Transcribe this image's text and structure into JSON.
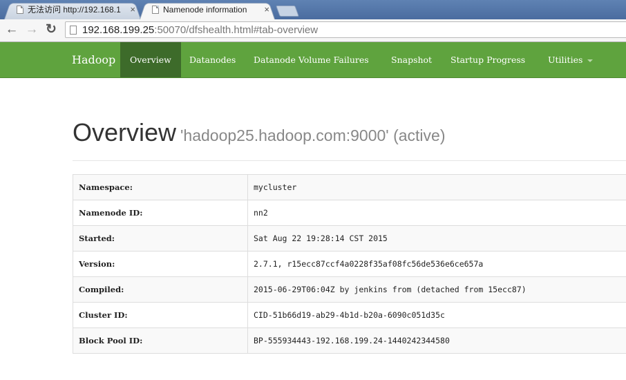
{
  "browser": {
    "tabs": [
      {
        "title": "无法访问 http://192.168.1",
        "close": "×"
      },
      {
        "title": "Namenode information",
        "close": "×"
      }
    ],
    "nav": {
      "back": "←",
      "forward": "→",
      "reload": "↻"
    },
    "url": {
      "host": "192.168.199.25",
      "rest": ":50070/dfshealth.html#tab-overview"
    }
  },
  "navbar": {
    "brand": "Hadoop",
    "items": [
      "Overview",
      "Datanodes",
      "Datanode Volume Failures",
      "Snapshot",
      "Startup Progress",
      "Utilities"
    ],
    "active": "Overview"
  },
  "header": {
    "title": "Overview",
    "subtitle": "'hadoop25.hadoop.com:9000' (active)"
  },
  "overview": {
    "rows": [
      {
        "key": "Namespace:",
        "value": "mycluster"
      },
      {
        "key": "Namenode ID:",
        "value": "nn2"
      },
      {
        "key": "Started:",
        "value": "Sat Aug 22 19:28:14 CST 2015"
      },
      {
        "key": "Version:",
        "value": "2.7.1, r15ecc87ccf4a0228f35af08fc56de536e6ce657a"
      },
      {
        "key": "Compiled:",
        "value": "2015-06-29T06:04Z by jenkins from (detached from 15ecc87)"
      },
      {
        "key": "Cluster ID:",
        "value": "CID-51b66d19-ab29-4b1d-b20a-6090c051d35c"
      },
      {
        "key": "Block Pool ID:",
        "value": "BP-555934443-192.168.199.24-1440242344580"
      }
    ]
  }
}
